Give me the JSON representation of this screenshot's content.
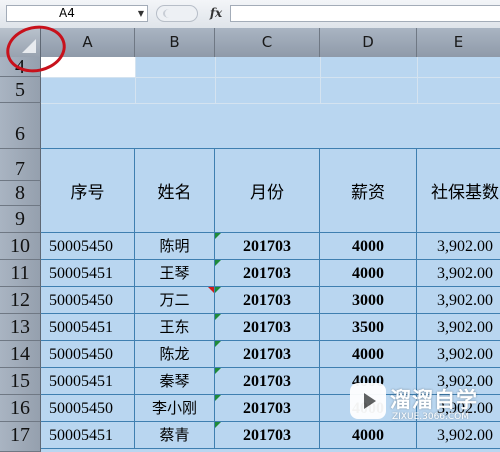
{
  "formula_bar": {
    "name_box": "A4",
    "fx_label": "fx",
    "formula_value": ""
  },
  "columns": [
    "A",
    "B",
    "C",
    "D",
    "E"
  ],
  "rows": [
    "4",
    "5",
    "6",
    "7",
    "8",
    "9",
    "10",
    "11",
    "12",
    "13",
    "14",
    "15",
    "16",
    "17"
  ],
  "table": {
    "headers": [
      "序号",
      "姓名",
      "月份",
      "薪资",
      "社保基数"
    ],
    "rows": [
      {
        "id": "50005450",
        "name": "陈明",
        "month": "201703",
        "salary": "4000",
        "base": "3,902.00"
      },
      {
        "id": "50005451",
        "name": "王琴",
        "month": "201703",
        "salary": "4000",
        "base": "3,902.00"
      },
      {
        "id": "50005450",
        "name": "万二",
        "month": "201703",
        "salary": "3000",
        "base": "3,902.00"
      },
      {
        "id": "50005451",
        "name": "王东",
        "month": "201703",
        "salary": "3500",
        "base": "3,902.00"
      },
      {
        "id": "50005450",
        "name": "陈龙",
        "month": "201703",
        "salary": "4000",
        "base": "3,902.00"
      },
      {
        "id": "50005451",
        "name": "秦琴",
        "month": "201703",
        "salary": "4000",
        "base": "3,902.00"
      },
      {
        "id": "50005450",
        "name": "李小刚",
        "month": "201703",
        "salary": "4000",
        "base": "3,902.00"
      },
      {
        "id": "50005451",
        "name": "蔡青",
        "month": "201703",
        "salary": "4000",
        "base": "3,902.00"
      }
    ]
  },
  "watermark": {
    "title": "溜溜自学",
    "url": "ZIXUE.3066.COM"
  },
  "colors": {
    "selection_fill": "#b9d6f0",
    "grid_line": "#3f7fb0",
    "annotation_circle": "#c8111b",
    "comment_indicator": "#d21c1c",
    "error_indicator": "#1f8a3a"
  }
}
